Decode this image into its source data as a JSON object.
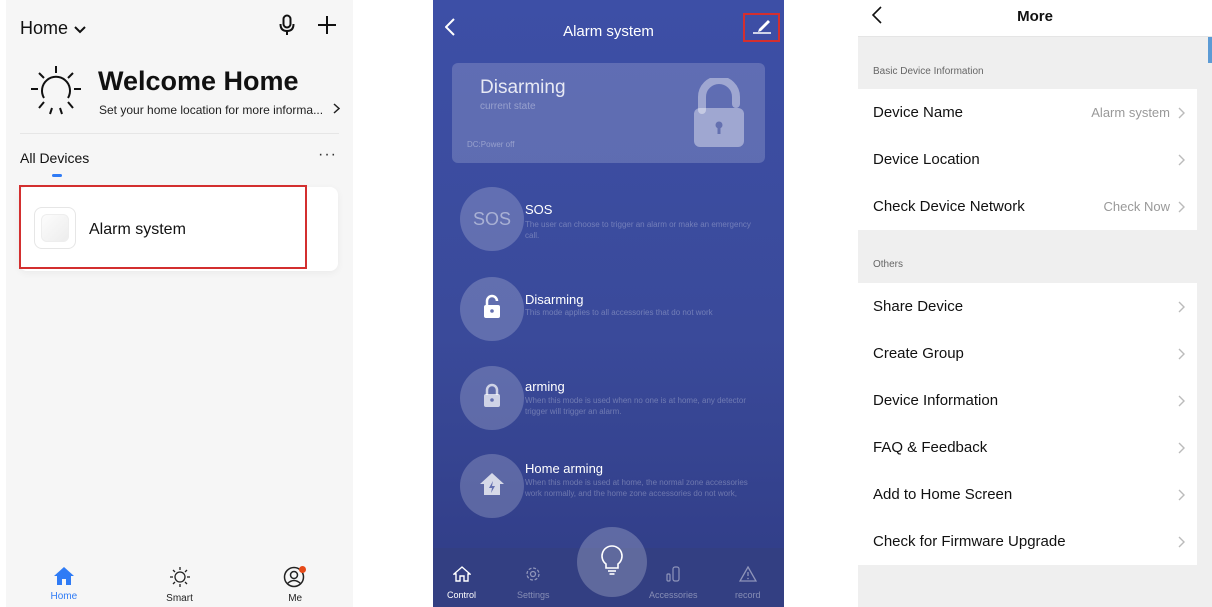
{
  "home": {
    "title": "Home",
    "welcome_title": "Welcome Home",
    "welcome_subtitle": "Set your home location for more informa...",
    "section_label": "All Devices",
    "more_label": "···",
    "device": {
      "name": "Alarm system",
      "icon": "device-tile-icon"
    },
    "tabs": [
      {
        "label": "Home",
        "icon": "home-icon",
        "active": true
      },
      {
        "label": "Smart",
        "icon": "sun-icon",
        "active": false
      },
      {
        "label": "Me",
        "icon": "profile-icon",
        "active": false
      }
    ],
    "colors": {
      "accent": "#2f7bf5",
      "highlight": "#d32f2f"
    }
  },
  "alarm": {
    "title": "Alarm system",
    "state": {
      "title": "Disarming",
      "subtitle": "current state",
      "power": "DC:Power off"
    },
    "modes": [
      {
        "title": "SOS",
        "badge": "SOS",
        "description": "The user can choose to trigger an alarm or make an emergency call."
      },
      {
        "title": "Disarming",
        "description": "This mode applies to all accessories that do not work",
        "icon": "unlock-icon"
      },
      {
        "title": "arming",
        "description": "When this mode is used when no one is at home, any detector trigger will trigger an alarm.",
        "icon": "lock-icon"
      },
      {
        "title": "Home arming",
        "description": "When this mode is used at home, the normal zone accessories work normally, and the home zone accessories do not work,",
        "icon": "home-arming-icon"
      }
    ],
    "tabs": [
      {
        "label": "Control",
        "icon": "home-outline-icon",
        "active": true
      },
      {
        "label": "Settings",
        "icon": "gear-icon",
        "active": false
      },
      {
        "label": "Accessories",
        "icon": "accessories-icon",
        "active": false
      },
      {
        "label": "record",
        "icon": "warning-icon",
        "active": false
      }
    ],
    "colors": {
      "background": "#3d4fa6",
      "highlight": "#d32f2f"
    }
  },
  "more": {
    "title": "More",
    "sections": [
      {
        "header": "Basic Device Information",
        "rows": [
          {
            "label": "Device Name",
            "value": "Alarm system"
          },
          {
            "label": "Device Location",
            "value": ""
          },
          {
            "label": "Check Device Network",
            "value": "Check Now"
          }
        ]
      },
      {
        "header": "Others",
        "rows": [
          {
            "label": "Share Device",
            "value": ""
          },
          {
            "label": "Create Group",
            "value": ""
          },
          {
            "label": "Device Information",
            "value": ""
          },
          {
            "label": "FAQ & Feedback",
            "value": ""
          },
          {
            "label": "Add to Home Screen",
            "value": ""
          },
          {
            "label": "Check for Firmware Upgrade",
            "value": ""
          }
        ]
      }
    ]
  }
}
